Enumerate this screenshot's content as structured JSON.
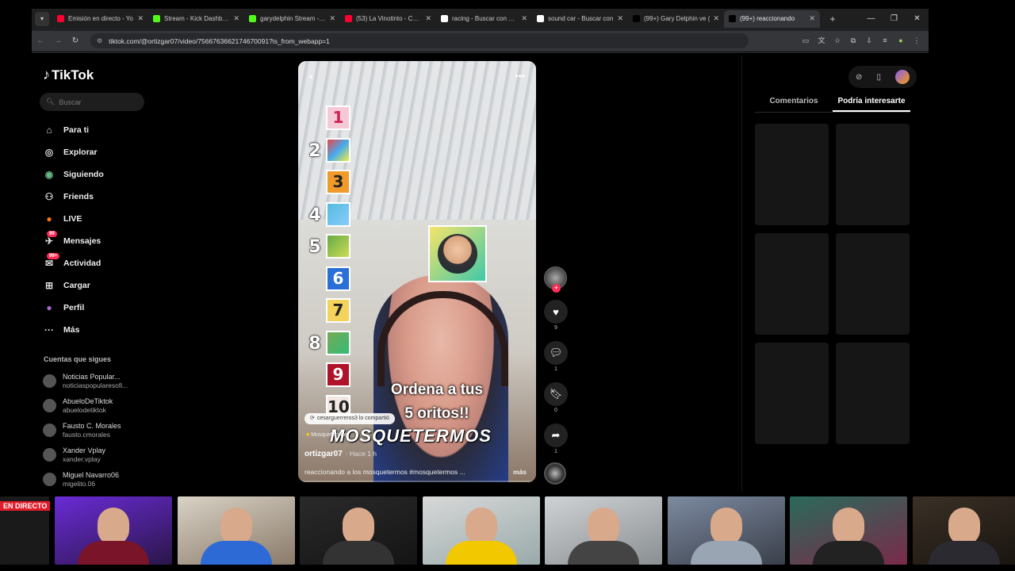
{
  "browser": {
    "tabs": [
      {
        "title": "Emisión en directo - Yo",
        "favicon": "youtube-icon",
        "color": "#ff0033"
      },
      {
        "title": "Stream - Kick Dashboard",
        "favicon": "kick-icon",
        "color": "#53fc18"
      },
      {
        "title": "garydelphin Stream - W",
        "favicon": "kick-icon",
        "color": "#53fc18"
      },
      {
        "title": "(53) La Vinotinto - Caran",
        "favicon": "youtube-icon",
        "color": "#ff0033"
      },
      {
        "title": "racing - Buscar con Goo",
        "favicon": "google-icon",
        "color": "#ffffff"
      },
      {
        "title": "sound car - Buscar con",
        "favicon": "google-icon",
        "color": "#ffffff"
      },
      {
        "title": "(99+) Gary Delphin ve (",
        "favicon": "tiktok-icon",
        "color": "#000000"
      },
      {
        "title": "(99+) reaccionando",
        "favicon": "tiktok-icon",
        "color": "#000000"
      }
    ],
    "url": "tiktok.com/@ortizgar07/video/7566763662174670091?is_from_webapp=1"
  },
  "tiktok": {
    "logo": "TikTok",
    "search_placeholder": "Buscar",
    "nav": [
      {
        "label": "Para ti",
        "icon": "home-icon"
      },
      {
        "label": "Explorar",
        "icon": "compass-icon"
      },
      {
        "label": "Siguiendo",
        "icon": "following-icon"
      },
      {
        "label": "Friends",
        "icon": "friends-icon"
      },
      {
        "label": "LIVE",
        "icon": "live-icon"
      },
      {
        "label": "Mensajes",
        "icon": "messages-icon",
        "badge": "99"
      },
      {
        "label": "Actividad",
        "icon": "activity-icon",
        "badge": "99+"
      },
      {
        "label": "Cargar",
        "icon": "upload-icon"
      },
      {
        "label": "Perfil",
        "icon": "profile-icon"
      },
      {
        "label": "Más",
        "icon": "more-icon"
      }
    ],
    "following_header": "Cuentas que sigues",
    "following": [
      {
        "name": "Noticias Popular...",
        "user": "noticiaspopularesofi..."
      },
      {
        "name": "AbueloDeTiktok",
        "user": "abuelodetiktok"
      },
      {
        "name": "Fausto C. Morales",
        "user": "fausto.cmorales"
      },
      {
        "name": "Xander Vplay",
        "user": "xander.vplay"
      },
      {
        "name": "Miguel Navarro06",
        "user": "migelito.06"
      }
    ]
  },
  "video": {
    "ranks": [
      {
        "n": "1",
        "style": "box",
        "bg": "#f6c9d6",
        "fg": "#c25"
      },
      {
        "n": "2",
        "style": "thumb",
        "bg": "linear-gradient(135deg,#e44,#4ae,#ee4)"
      },
      {
        "n": "3",
        "style": "box",
        "bg": "#f09a2a",
        "fg": "#222"
      },
      {
        "n": "4",
        "style": "thumb",
        "bg": "linear-gradient(135deg,#5bd,#8cf)"
      },
      {
        "n": "5",
        "style": "thumb",
        "bg": "linear-gradient(135deg,#6a4,#cd5)"
      },
      {
        "n": "6",
        "style": "box",
        "bg": "#2a6fd6",
        "fg": "#fff"
      },
      {
        "n": "7",
        "style": "box",
        "bg": "#f3d35b",
        "fg": "#222"
      },
      {
        "n": "8",
        "style": "thumb",
        "bg": "linear-gradient(135deg,#7a5,#3b7)"
      },
      {
        "n": "9",
        "style": "box",
        "bg": "#b0122a",
        "fg": "#fff"
      },
      {
        "n": "10",
        "style": "box",
        "bg": "#f2e7e2",
        "fg": "#222"
      }
    ],
    "caption_line1": "Ordena a tus",
    "caption_line2": "5 oritos!!",
    "watermark": "MOSQUETERMOS",
    "shared_by": "cesarguerreros3 lo compartió",
    "effect": "Mosquetermos",
    "author": "ortizgar07",
    "posted": "· Hace 1 h",
    "description": "reaccionando a los mosquetermos #mosquetermos ...",
    "more_label": "más",
    "progress": 0.0
  },
  "actions": [
    {
      "icon": "heart-icon",
      "count": "9"
    },
    {
      "icon": "comment-icon",
      "count": "1"
    },
    {
      "icon": "bookmark-icon",
      "count": "0"
    },
    {
      "icon": "share-icon",
      "count": "1"
    }
  ],
  "right_panel": {
    "tabs": [
      "Comentarios",
      "Podría interesarte"
    ],
    "active_tab": 1,
    "tiles": 6
  },
  "strip": {
    "live_tag": "EN DIRECTO",
    "cams": [
      {
        "bg": "linear-gradient(160deg,#6a2bd6,#2a1648)",
        "shirt": "#7a1428"
      },
      {
        "bg": "linear-gradient(160deg,#d8d2c5,#8a7a6a)",
        "shirt": "#2d6ad6"
      },
      {
        "bg": "linear-gradient(160deg,#2a2a2a,#141414)",
        "shirt": "#333"
      },
      {
        "bg": "linear-gradient(160deg,#d8d8d8,#9aa)",
        "shirt": "#f2c800"
      },
      {
        "bg": "linear-gradient(160deg,#cfd2d4,#8a8f92)",
        "shirt": "#444"
      },
      {
        "bg": "linear-gradient(160deg,#7c8aa0,#3a3f4a)",
        "shirt": "#9aa5b4"
      },
      {
        "bg": "linear-gradient(160deg,#2a6a5a,#7a2a4a)",
        "shirt": "#222"
      },
      {
        "bg": "linear-gradient(160deg,#3a3026,#1a1510)",
        "shirt": "#2a2a30"
      }
    ]
  }
}
